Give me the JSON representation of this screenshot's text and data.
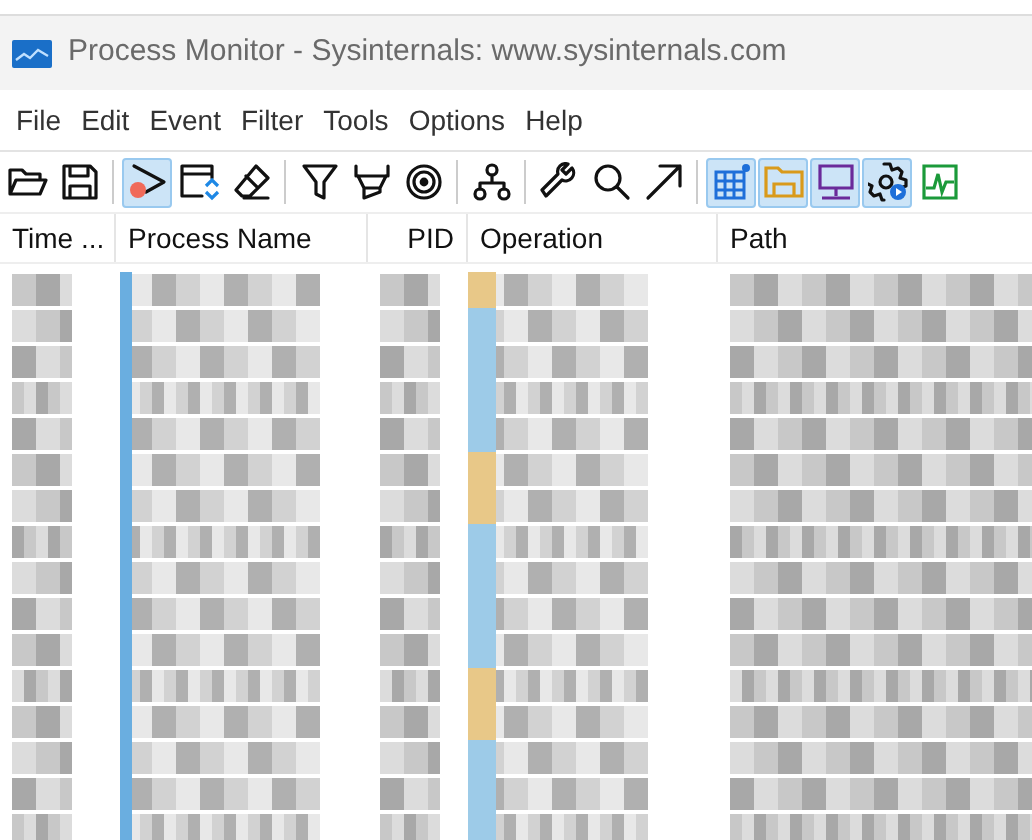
{
  "window": {
    "title": "Process Monitor - Sysinternals: www.sysinternals.com"
  },
  "menu": [
    "File",
    "Edit",
    "Event",
    "Filter",
    "Tools",
    "Options",
    "Help"
  ],
  "toolbar": [
    {
      "kind": "open",
      "selected": false
    },
    {
      "kind": "save",
      "selected": false
    },
    {
      "kind": "sep"
    },
    {
      "kind": "capture",
      "selected": true
    },
    {
      "kind": "autoscroll",
      "selected": false
    },
    {
      "kind": "clear",
      "selected": false
    },
    {
      "kind": "sep"
    },
    {
      "kind": "filter",
      "selected": false
    },
    {
      "kind": "highlight",
      "selected": false
    },
    {
      "kind": "target",
      "selected": false
    },
    {
      "kind": "sep"
    },
    {
      "kind": "tree",
      "selected": false
    },
    {
      "kind": "sep"
    },
    {
      "kind": "wrench",
      "selected": false
    },
    {
      "kind": "search",
      "selected": false
    },
    {
      "kind": "jump",
      "selected": false
    },
    {
      "kind": "sep"
    },
    {
      "kind": "registry",
      "selected": true
    },
    {
      "kind": "filesystem",
      "selected": true
    },
    {
      "kind": "network",
      "selected": true
    },
    {
      "kind": "process",
      "selected": true
    },
    {
      "kind": "profiling",
      "selected": false
    }
  ],
  "table": {
    "columns": [
      "Time ...",
      "Process Name",
      "PID",
      "Operation",
      "Path"
    ]
  }
}
